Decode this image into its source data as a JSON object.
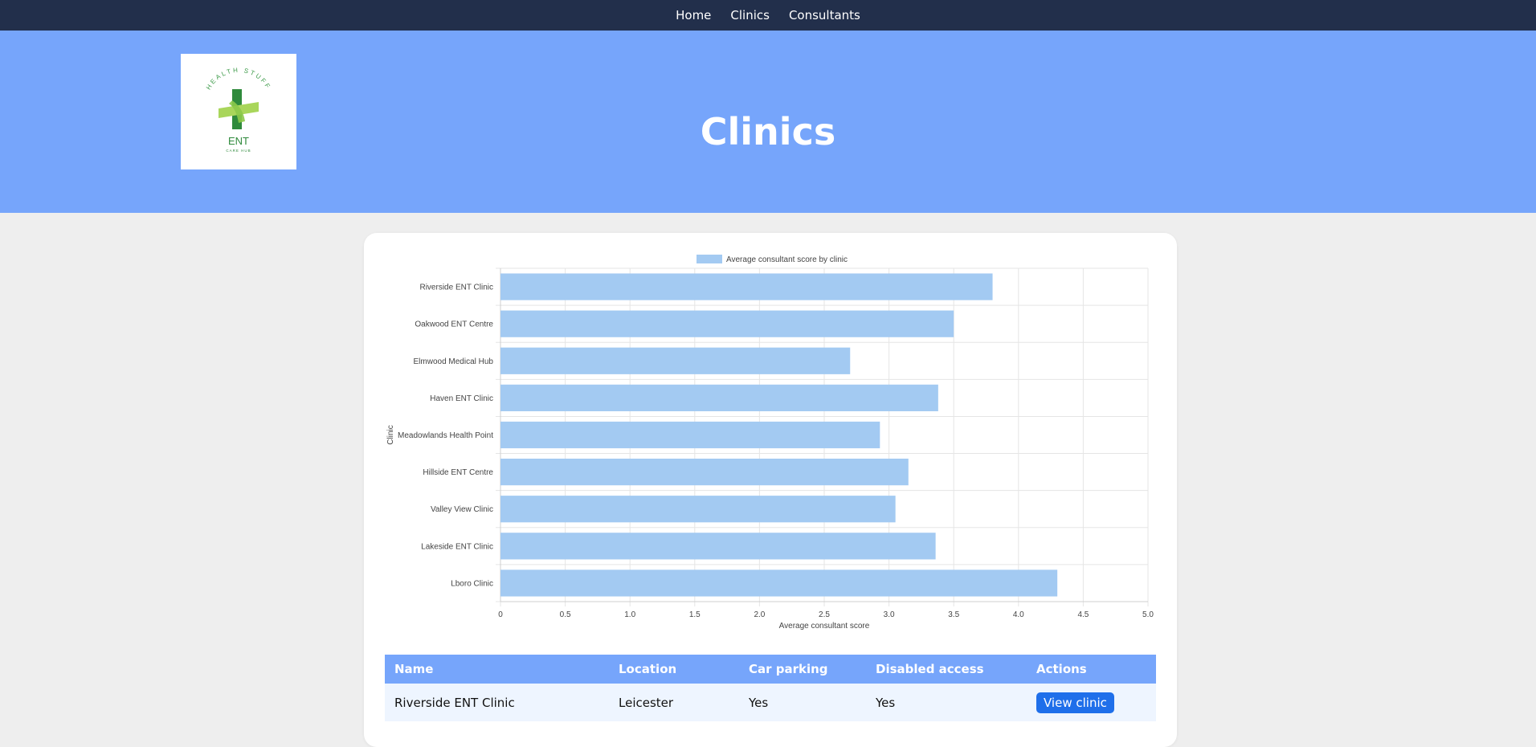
{
  "nav": {
    "items": [
      {
        "label": "Home"
      },
      {
        "label": "Clinics"
      },
      {
        "label": "Consultants"
      }
    ]
  },
  "hero": {
    "title": "Clinics",
    "logo": {
      "arc_text": "HEALTH STUFF",
      "main_text": "ENT",
      "sub_text": "CARE HUB"
    }
  },
  "colors": {
    "nav_bg": "#222f4b",
    "hero_bg": "#76a5fb",
    "bar_fill": "#a3caf2",
    "button": "#1f6fea"
  },
  "chart_data": {
    "type": "bar",
    "orientation": "horizontal",
    "legend": "top",
    "grid": true,
    "categories": [
      "Riverside ENT Clinic",
      "Oakwood ENT Centre",
      "Elmwood Medical Hub",
      "Haven ENT Clinic",
      "Meadowlands Health Point",
      "Hillside ENT Centre",
      "Valley View Clinic",
      "Lakeside ENT Clinic",
      "Lboro Clinic"
    ],
    "series": [
      {
        "name": "Average consultant score by clinic",
        "values": [
          3.8,
          3.5,
          2.7,
          3.38,
          2.93,
          3.15,
          3.05,
          3.36,
          4.3
        ]
      }
    ],
    "xlabel": "Average consultant score",
    "ylabel": "Clinic",
    "xlim": [
      0,
      5
    ],
    "xticks": [
      "0",
      "0.5",
      "1.0",
      "1.5",
      "2.0",
      "2.5",
      "3.0",
      "3.5",
      "4.0",
      "4.5",
      "5.0"
    ]
  },
  "table": {
    "headers": [
      "Name",
      "Location",
      "Car parking",
      "Disabled access",
      "Actions"
    ],
    "rows": [
      {
        "name": "Riverside ENT Clinic",
        "location": "Leicester",
        "parking": "Yes",
        "access": "Yes",
        "action": "View clinic"
      }
    ]
  }
}
